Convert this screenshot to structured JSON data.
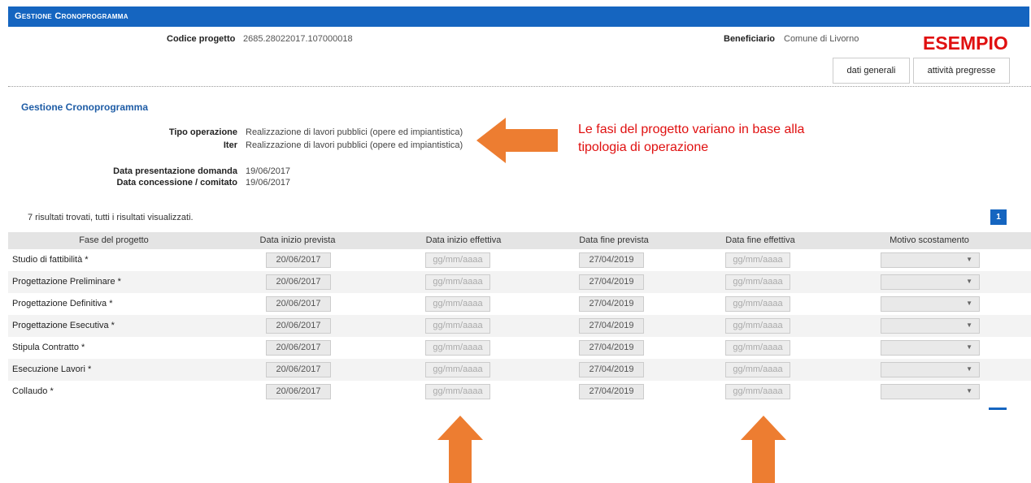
{
  "window_title": "Gestione Cronoprogramma",
  "header": {
    "codice_label": "Codice progetto",
    "codice_value": "2685.28022017.107000018",
    "beneficiario_label": "Beneficiario",
    "beneficiario_value": "Comune di Livorno",
    "esempio": "ESEMPIO"
  },
  "buttons": {
    "dati_generali": "dati generali",
    "attivita": "attività pregresse"
  },
  "section_title": "Gestione Cronoprogramma",
  "info": {
    "tipo_label": "Tipo operazione",
    "tipo_value": "Realizzazione di lavori pubblici (opere ed impiantistica)",
    "iter_label": "Iter",
    "iter_value": "Realizzazione di lavori pubblici (opere ed impiantistica)",
    "presentazione_label": "Data presentazione domanda",
    "presentazione_value": "19/06/2017",
    "concessione_label": "Data concessione / comitato",
    "concessione_value": "19/06/2017"
  },
  "annotation": {
    "line1": "Le fasi del progetto variano in base alla",
    "line2": "tipologia di operazione"
  },
  "results_text": "7 risultati trovati, tutti i risultati visualizzati.",
  "pager": {
    "page": "1"
  },
  "columns": [
    "Fase del progetto",
    "Data inizio prevista",
    "Data inizio effettiva",
    "Data fine prevista",
    "Data fine effettiva",
    "Motivo scostamento"
  ],
  "rows": [
    {
      "fase": "Studio di fattibilità *",
      "inizio_prevista": "20/06/2017",
      "inizio_effettiva": "gg/mm/aaaa",
      "fine_prevista": "27/04/2019",
      "fine_effettiva": "gg/mm/aaaa"
    },
    {
      "fase": "Progettazione Preliminare *",
      "inizio_prevista": "20/06/2017",
      "inizio_effettiva": "gg/mm/aaaa",
      "fine_prevista": "27/04/2019",
      "fine_effettiva": "gg/mm/aaaa"
    },
    {
      "fase": "Progettazione Definitiva *",
      "inizio_prevista": "20/06/2017",
      "inizio_effettiva": "gg/mm/aaaa",
      "fine_prevista": "27/04/2019",
      "fine_effettiva": "gg/mm/aaaa"
    },
    {
      "fase": "Progettazione Esecutiva *",
      "inizio_prevista": "20/06/2017",
      "inizio_effettiva": "gg/mm/aaaa",
      "fine_prevista": "27/04/2019",
      "fine_effettiva": "gg/mm/aaaa"
    },
    {
      "fase": "Stipula Contratto *",
      "inizio_prevista": "20/06/2017",
      "inizio_effettiva": "gg/mm/aaaa",
      "fine_prevista": "27/04/2019",
      "fine_effettiva": "gg/mm/aaaa"
    },
    {
      "fase": "Esecuzione Lavori *",
      "inizio_prevista": "20/06/2017",
      "inizio_effettiva": "gg/mm/aaaa",
      "fine_prevista": "27/04/2019",
      "fine_effettiva": "gg/mm/aaaa"
    },
    {
      "fase": "Collaudo *",
      "inizio_prevista": "20/06/2017",
      "inizio_effettiva": "gg/mm/aaaa",
      "fine_prevista": "27/04/2019",
      "fine_effettiva": "gg/mm/aaaa"
    }
  ],
  "colors": {
    "brand_blue": "#1565c0",
    "annotation_red": "#e01010",
    "arrow_orange": "#ed7d31"
  },
  "icons": {
    "select_arrow": "chevron-down-icon",
    "arrow_left": "arrow-left-icon",
    "arrow_up": "arrow-up-icon"
  }
}
